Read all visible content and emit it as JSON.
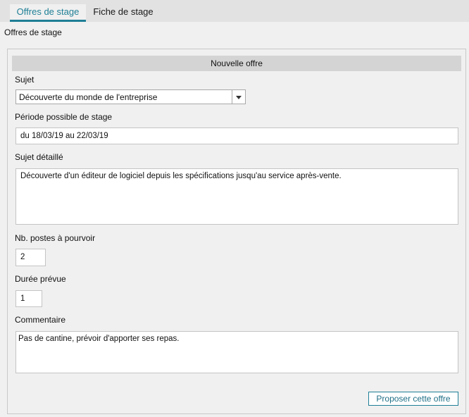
{
  "tabs": [
    {
      "label": "Offres de stage",
      "active": true
    },
    {
      "label": "Fiche de stage",
      "active": false
    }
  ],
  "page_title": "Offres de stage",
  "form": {
    "header": "Nouvelle offre",
    "sujet": {
      "label": "Sujet",
      "value": "Découverte du monde de l'entreprise"
    },
    "periode": {
      "label": "Période possible de stage",
      "value": "du 18/03/19 au 22/03/19"
    },
    "sujet_detaille": {
      "label": "Sujet détaillé",
      "value": "Découverte d'un éditeur de logiciel depuis les spécifications jusqu'au service après-vente."
    },
    "nb_postes": {
      "label": "Nb. postes à pourvoir",
      "value": "2"
    },
    "duree": {
      "label": "Durée prévue",
      "value": "1"
    },
    "commentaire": {
      "label": "Commentaire",
      "value": "Pas de cantine, prévoir d'apporter ses repas."
    },
    "submit_label": "Proposer cette offre"
  },
  "icons": {
    "dropdown": "chevron-down-icon"
  },
  "colors": {
    "accent": "#1f7f96",
    "tab_bar": "#e2e2e2",
    "header_bg": "#d4d4d4"
  }
}
